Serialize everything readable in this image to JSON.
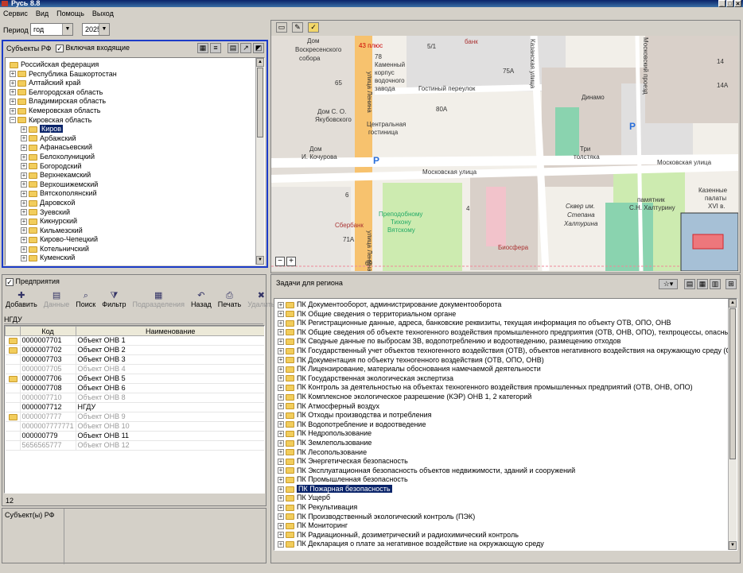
{
  "window": {
    "title": "Русь 8.8",
    "buttons": [
      "_",
      "□",
      "✕"
    ]
  },
  "menu": [
    "Сервис",
    "Вид",
    "Помощь",
    "Выход"
  ],
  "period": {
    "label": "Период",
    "unit": "год",
    "year": "2025"
  },
  "subjects": {
    "title": "Субъекты РФ",
    "include_label": "Включая входящие",
    "root": "Российская федерация",
    "regions": [
      "Республика Башкортостан",
      "Алтайский край",
      "Белгородская область",
      "Владимирская область",
      "Кемеровская область",
      "Кировская область"
    ],
    "districts": [
      "Киров",
      "Арбажский",
      "Афанасьевский",
      "Белохолуницкий",
      "Богородский",
      "Верхнекамский",
      "Верхошижемский",
      "Вятскополянский",
      "Даровской",
      "Зуевский",
      "Кикнурский",
      "Кильмезский",
      "Кирово-Чепецкий",
      "Котельничский",
      "Куменский"
    ]
  },
  "map": {
    "labels": {
      "dom1": "Дом",
      "voskr": "Воскресенского",
      "sobora": "собора",
      "plus": "43 плюс",
      "bank": "банк",
      "kazan": "Казанская улица",
      "moskprozd": "Московский проезд",
      "kamenny": "Каменный",
      "korpus": "корпус",
      "vodo": "водочного",
      "zavoda": "завода",
      "gost": "Гостиный переулок",
      "dinamo": "Динамо",
      "domsoyak1": "Дом С. О.",
      "domsoyak2": "Якубовского",
      "centr": "Центральная",
      "gost2": "гостиница",
      "tri": "Три",
      "tolsty": "толстяка",
      "domkoch1": "Дом",
      "domkoch2": "И. Кочурова",
      "mosk1": "Московская улица",
      "mosk2": "Московская улица",
      "lenina": "улица Ленина",
      "lenina2": "улица Ленина",
      "kazpal": "Казенные",
      "palaty": "палаты",
      "xvi": "XVI в.",
      "pamyat": "памятник",
      "halt": "С.Н. Халтурину",
      "skver1": "Сквер им.",
      "skver2": "Степана",
      "skver3": "Халтурина",
      "tihon1": "Преподобному",
      "tihon2": "Тихону",
      "tihon3": "Вятскому",
      "sber": "Сбербанк",
      "biosf": "Биосфера",
      "n78": "78",
      "n51": "5/1",
      "n75a": "75А",
      "n14": "14",
      "n14a": "14А",
      "n65": "65",
      "n80a": "80А",
      "n6": "6",
      "n4": "4",
      "n71a": "71А",
      "n69": "69"
    }
  },
  "enterprises": {
    "title": "Предприятия",
    "toolbar": [
      "Добавить",
      "Данные",
      "Поиск",
      "Фильтр",
      "Подразделения",
      "Назад",
      "Печать",
      "Удалить"
    ],
    "disabled": [
      false,
      true,
      false,
      false,
      true,
      false,
      false,
      true
    ],
    "filter": "НГДУ",
    "col_code": "Код",
    "col_name": "Наименование",
    "rows": [
      {
        "code": "0000007701",
        "name": "Объект ОНВ 1",
        "f": true,
        "g": false
      },
      {
        "code": "0000007702",
        "name": "Объект ОНВ 2",
        "f": true,
        "g": false
      },
      {
        "code": "0000007703",
        "name": "Объект ОНВ 3",
        "f": false,
        "g": false
      },
      {
        "code": "0000007705",
        "name": "Объект ОНВ 4",
        "f": false,
        "g": true
      },
      {
        "code": "0000007706",
        "name": "Объект ОНВ 5",
        "f": true,
        "g": false
      },
      {
        "code": "0000007708",
        "name": "Объект ОНВ 6",
        "f": false,
        "g": false
      },
      {
        "code": "0000007710",
        "name": "Объект ОНВ 8",
        "f": false,
        "g": true
      },
      {
        "code": "0000007712",
        "name": "НГДУ",
        "f": false,
        "g": false
      },
      {
        "code": "0000007777",
        "name": "Объект ОНВ 9",
        "f": true,
        "g": true
      },
      {
        "code": "0000007777771",
        "name": "Объект ОНВ 10",
        "f": false,
        "g": true
      },
      {
        "code": "000000779",
        "name": "Объект ОНВ 11",
        "f": false,
        "g": false
      },
      {
        "code": "5656565777",
        "name": "Объект ОНВ 12",
        "f": false,
        "g": true
      }
    ],
    "count": "12"
  },
  "subjects_footer": "Субъект(ы) РФ",
  "tasks": {
    "title": "Задачи для региона",
    "selected": "ПК Пожарная безопасность",
    "items": [
      "ПК Документооборот, администрирование документооборота",
      "ПК Общие сведения о территориальном органе",
      "ПК Регистрационные данные, адреса, банковские реквизиты, текущая информация по объекту ОТВ, ОПО, ОНВ",
      "ПК Общие сведения об объекте техногенного воздействия промышленного предприятия (ОТВ, ОНВ, ОПО),  техпроцессы, опасные материалы, с",
      "ПК Сводные данные по выбросам ЗВ, водопотреблению и водоотведению, размещению отходов",
      "ПК Государственный учет объектов техногенного воздействия (ОТВ), объектов негативного воздействия на окружающую среду (ОНВ, ОПО)",
      "ПК Документация по объекту техногенного воздействия (ОТВ, ОПО, ОНВ)",
      "ПК Лицензирование, материалы обоснования намечаемой деятельности",
      "ПК Государственная экологическая экспертиза",
      "ПК Контроль за деятельностью на объектах техногенного воздействия промышленных предприятий (ОТВ, ОНВ, ОПО)",
      "ПК Комплексное экологическое разрешение (КЭР) ОНВ 1, 2 категорий",
      "ПК Атмосферный воздух",
      "ПК Отходы производства и потребления",
      "ПК Водопотребление и водоотведение",
      "ПК Недропользование",
      "ПК Землепользование",
      "ПК Лесопользование",
      "ПК Энергетическая безопасность",
      "ПК Эксплуатационная безопасность объектов недвижимости, зданий и сооружений",
      "ПК Промышленная безопасность",
      "ПК Пожарная безопасность",
      "ПК Ущерб",
      "ПК Рекультивация",
      "ПК Производственный экологический контроль (ПЭК)",
      "ПК Мониторинг",
      "ПК Радиационный, дозиметрический и радиохимический контроль",
      "ПК Декларация о плате за негативное воздействие на окружающую среду"
    ]
  }
}
